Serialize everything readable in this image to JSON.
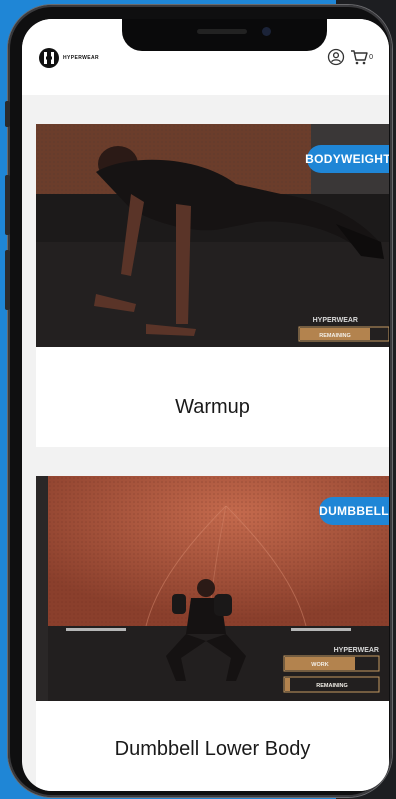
{
  "brand": {
    "name": "HYPERWEAR"
  },
  "header": {
    "cart_count": "0"
  },
  "workouts": [
    {
      "title": "Warmup",
      "tag": "BODYWEIGHT",
      "video_overlay": {
        "brand": "HYPERWEAR",
        "labels": [
          "REMAINING"
        ]
      }
    },
    {
      "title": "Dumbbell Lower Body",
      "tag": "DUMBBELL",
      "video_overlay": {
        "brand": "HYPERWEAR",
        "labels": [
          "WORK",
          "REMAINING"
        ]
      }
    }
  ],
  "colors": {
    "accent": "#1f86d6",
    "overlay_bar": "#b3834e"
  }
}
